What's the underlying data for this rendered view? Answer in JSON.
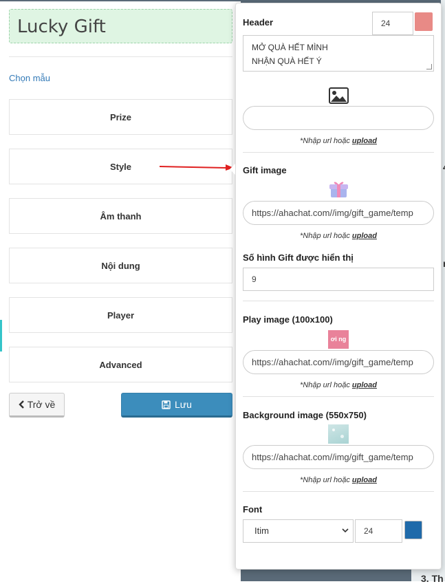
{
  "left": {
    "title": "Lucky Gift",
    "choose_template": "Chọn mẫu",
    "menu": [
      "Prize",
      "Style",
      "Âm thanh",
      "Nội dung",
      "Player",
      "Advanced"
    ],
    "back_label": "Trở về",
    "save_label": "Lưu"
  },
  "popover": {
    "header": {
      "label": "Header",
      "font_size": "24",
      "color": "#e88a86",
      "text_line1": "MỞ QUÀ HẾT MÌNH",
      "text_line2": "NHẬN QUÀ HẾT Ý"
    },
    "header_image": {
      "url": "",
      "icon": "image-icon"
    },
    "hint_prefix": "*Nhập url hoặc ",
    "hint_link": "upload",
    "gift_image": {
      "label": "Gift image",
      "url": "https://ahachat.com//img/gift_game/temp"
    },
    "gift_count": {
      "label": "Số hình Gift được hiển thị",
      "value": "9"
    },
    "play_image": {
      "label": "Play image (100x100)",
      "url": "https://ahachat.com//img/gift_game/temp",
      "thumb_text": "ơi ng"
    },
    "background_image": {
      "label": "Background image (550x750)",
      "url": "https://ahachat.com//img/gift_game/temp"
    },
    "font": {
      "label": "Font",
      "selected": "Itim",
      "size": "24",
      "color": "#1f6aaa"
    }
  },
  "background": {
    "glyph_right1": "4",
    "glyph_right2": "r",
    "glyph_bottom": "3. Th"
  }
}
